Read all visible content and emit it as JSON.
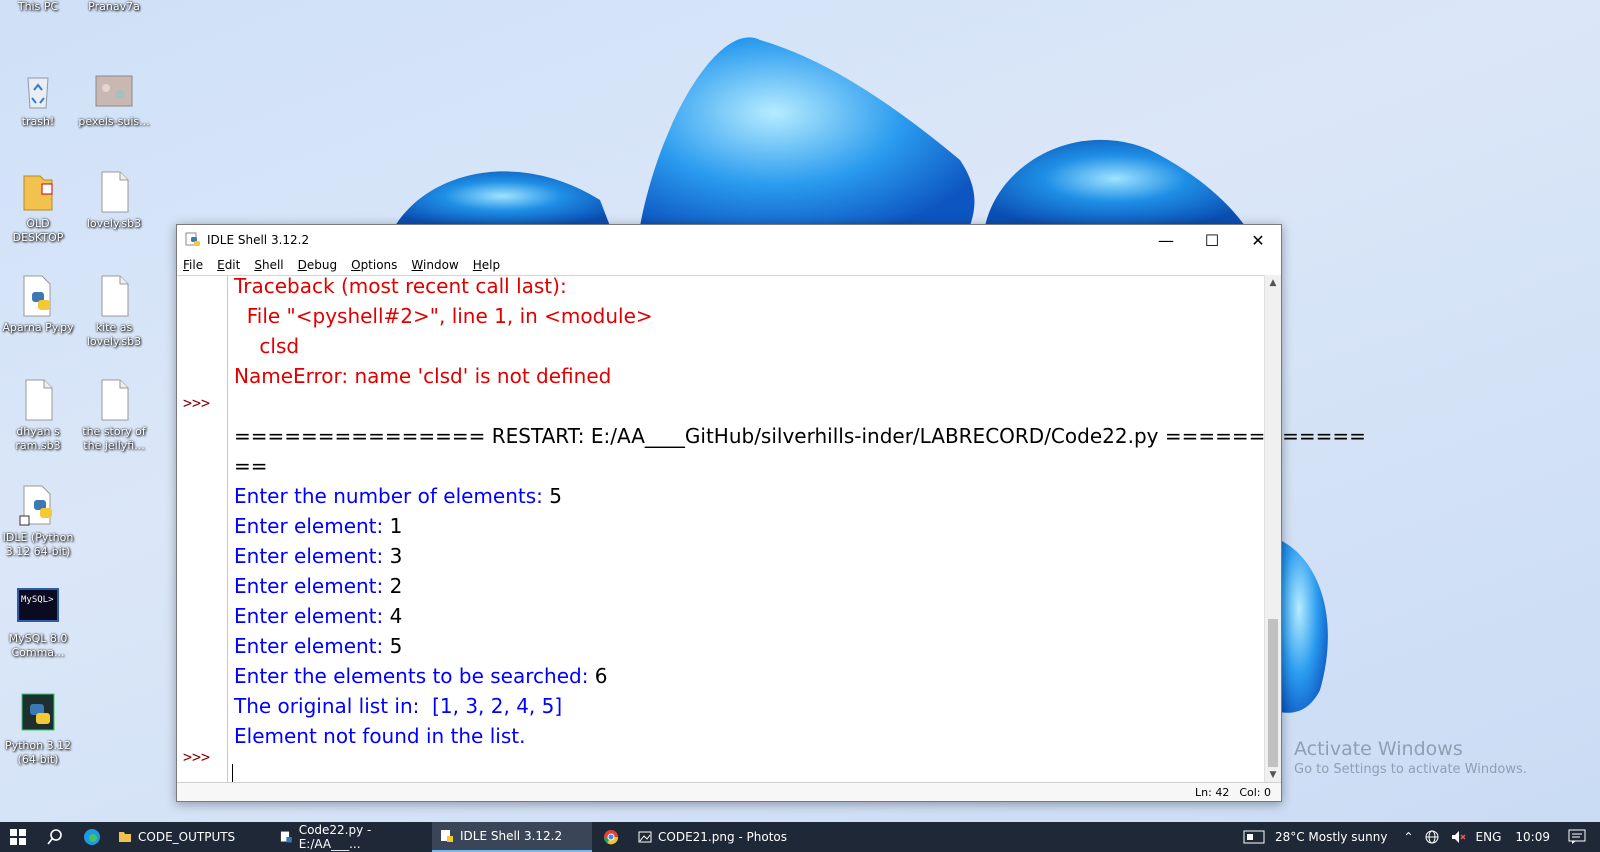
{
  "desktop": {
    "icons": [
      {
        "label": "This PC"
      },
      {
        "label": "Pranav7a"
      },
      {
        "label": "trash!"
      },
      {
        "label": "pexels-suis..."
      },
      {
        "label": "OLD DESKTOP"
      },
      {
        "label": "lovely.sb3"
      },
      {
        "label": "Aparna Py.py"
      },
      {
        "label": "kite as lovely.sb3"
      },
      {
        "label": "dhyan s ram.sb3"
      },
      {
        "label": "the story of the jellyfi..."
      },
      {
        "label": "IDLE (Python 3.12 64-bit)"
      },
      {
        "label": "MySQL 8.0 Comma..."
      },
      {
        "label": "Python 3.12 (64-bit)"
      }
    ],
    "mysql_glyph_text": "MySQL>"
  },
  "window": {
    "title": "IDLE Shell 3.12.2",
    "menu": [
      "File",
      "Edit",
      "Shell",
      "Debug",
      "Options",
      "Window",
      "Help"
    ],
    "prompt": ">>>",
    "lines": {
      "l1": "Traceback (most recent call last):",
      "l2": "  File \"<pyshell#2>\", line 1, in <module>",
      "l3": "    clsd",
      "l4": "NameError: name 'clsd' is not defined",
      "l5": "=============== RESTART: E:/AA____GitHub/silverhills-inder/LABRECORD/Code22.py ============",
      "l6": "==",
      "l7_label": "Enter the number of elements: ",
      "l7_value": "5",
      "l8_label": "Enter element: ",
      "l8_value": "1",
      "l9_label": "Enter element: ",
      "l9_value": "3",
      "l10_label": "Enter element: ",
      "l10_value": "2",
      "l11_label": "Enter element: ",
      "l11_value": "4",
      "l12_label": "Enter element: ",
      "l12_value": "5",
      "l13_label": "Enter the elements to be searched: ",
      "l13_value": "6",
      "l14": "The original list in:  [1, 3, 2, 4, 5]",
      "l15": "Element not found in the list."
    },
    "status": {
      "ln": "Ln: 42",
      "col": "Col: 0"
    }
  },
  "watermark": {
    "heading": "Activate Windows",
    "sub": "Go to Settings to activate Windows."
  },
  "taskbar": {
    "apps": [
      {
        "label": "CODE_OUTPUTS"
      },
      {
        "label": "Code22.py - E:/AA___..."
      },
      {
        "label": "IDLE Shell 3.12.2"
      },
      {
        "label": "CODE21.png - Photos"
      }
    ],
    "weather": "28°C  Mostly sunny",
    "lang": "ENG",
    "time": "10:09"
  },
  "colors": {
    "error_red": "#e10000",
    "output_blue": "#0000ff",
    "prompt_darkred": "#8b0000",
    "taskbar_bg": "#1f2836"
  }
}
